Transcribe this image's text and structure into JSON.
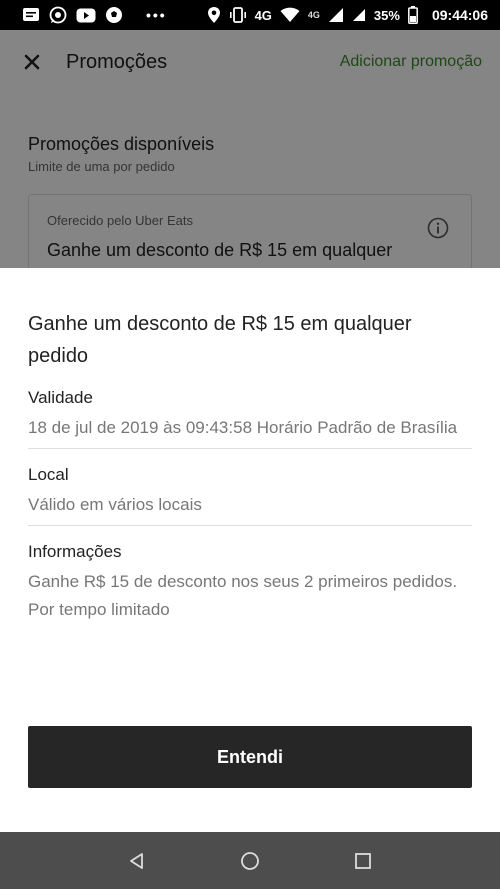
{
  "status_bar": {
    "network": "4G",
    "network_small": "4G",
    "battery": "35%",
    "time": "09:44:06"
  },
  "app_bar": {
    "title": "Promoções",
    "action": "Adicionar promoção"
  },
  "background": {
    "heading": "Promoções disponíveis",
    "subheading": "Limite de uma por pedido",
    "card_label": "Oferecido pelo Uber Eats",
    "card_title": "Ganhe um desconto de R$ 15 em qualquer"
  },
  "sheet": {
    "title": "Ganhe um desconto de R$ 15 em qualquer pedido",
    "sections": [
      {
        "label": "Validade",
        "value": "18 de jul de 2019 às 09:43:58 Horário Padrão de Brasília"
      },
      {
        "label": "Local",
        "value": "Válido em vários locais"
      },
      {
        "label": "Informações",
        "value": "Ganhe R$ 15 de desconto nos seus 2 primeiros pedidos. Por tempo limitado"
      }
    ],
    "button": "Entendi"
  },
  "colors": {
    "accent": "#3a8a2a",
    "button_bg": "#262626",
    "navbar_bg": "#4d4d4d"
  }
}
